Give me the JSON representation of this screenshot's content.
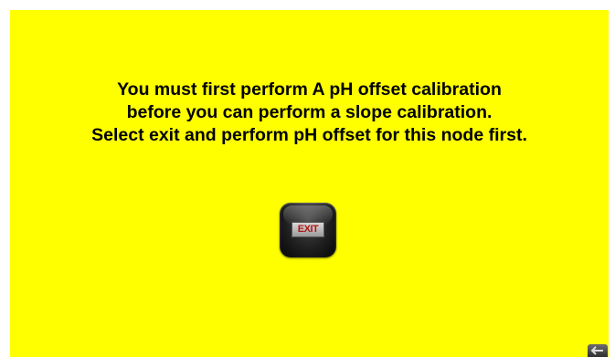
{
  "dialog": {
    "message_lines": [
      "You must first perform A pH offset calibration",
      "before you can perform a slope calibration.",
      "Select exit and perform pH offset for this node first."
    ],
    "exit_button_label": "EXIT"
  },
  "icons": {
    "corner_button": "back-arrow-icon"
  },
  "colors": {
    "panel_background": "#ffff00",
    "text": "#000000",
    "exit_label_text": "#b01818"
  }
}
